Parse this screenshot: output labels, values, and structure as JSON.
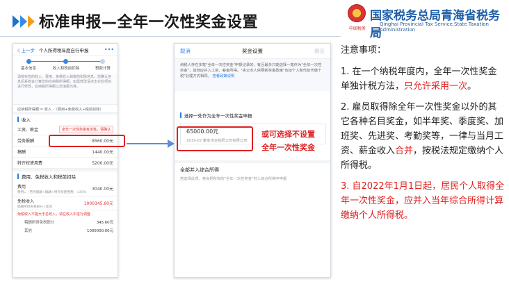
{
  "slide": {
    "title": "标准申报—全年一次性奖金设置",
    "logo_cn": "国家税务总局青海省税务局",
    "logo_en": "Qinghai Provincial Tax Service,State Taxation Administration",
    "logo_seal": "中国税务"
  },
  "phone1": {
    "back": "く上一步",
    "title": "个人所得税年度自行申报",
    "more": "•••",
    "steps": [
      "基本信息",
      "收入和税前扣除",
      "税款计算"
    ],
    "note": "请核实您的收入、费用、免税收入和税前扣除信息，您确认信息后系统会计算您的应纳税所得额，如需修改请点击对应项目进行修改，应纳税所得额以您填报为准。",
    "formula": "应纳税所得额 = 收入 -（费用+免税收入+税前扣除）",
    "income_section": "收入",
    "wage_label": "工资、薪金",
    "wage_tag": "全年一次性奖金有多笔，请确认",
    "rows": [
      {
        "label": "劳务报酬",
        "value": "8560.00元"
      },
      {
        "label": "稿酬",
        "value": "1440.00元"
      },
      {
        "label": "特许权使用费",
        "value": "5200.00元"
      }
    ],
    "deduct_section": "费用、免税收入和税前扣除",
    "fee_label": "费用",
    "fee_value": "3040.00元",
    "fee_sub": "费用=（劳务报酬+稿酬+特许权使用费）×20%",
    "exempt_label": "免税收入",
    "exempt_value": "1000345.60元",
    "exempt_sub": "稿酬所得免税部分+其他",
    "tax_warn": "免税收入不能大于总收入，请在收入中进行调整",
    "mini_rows": [
      {
        "label": "稿酬所得免税部分",
        "value": "345.60元"
      },
      {
        "label": "其他",
        "value": "1000000.00元"
      }
    ]
  },
  "phone2": {
    "cancel": "取消",
    "title": "奖金设置",
    "ok": "确定",
    "note": "纳税人存在多笔\"全年一次性奖金\"申报记录的，有且最多只能选择一笔作为\"全年一次性奖金\"，其他应并入工资、薪金所得。\"夹公杰人依照新奖金政策\"负担个人和代扣代缴个税\"处理方式相同。",
    "note_link": "查看政策说明",
    "option1_title": "选择一处作为全年一次性奖金申报",
    "option1_amount": "65000.00元",
    "option1_sub": "2019-02  聚享诗业有限公司有限公司",
    "option2_title": "全部并入综合所得",
    "option2_sub": "若选择此项，将会把所有的\"全年一次性奖金\"并入综合所得中申报"
  },
  "annotation": {
    "line1": "或可选择不设置",
    "line2": "全年一次性奖金"
  },
  "notes": {
    "heading": "注意事项：",
    "item1_a": "1. 在一个纳税年度内，全年一次性奖金单独计税方法，",
    "item1_b": "只允许采用一次",
    "item1_c": "。",
    "item2_a": "2. 雇员取得除全年一次性奖金以外的其它各种名目奖金，如半年奖、季度奖、加班奖、先进奖、考勤奖等，一律与当月工资、薪金收入",
    "item2_b": "合并",
    "item2_c": "，按税法规定缴纳个人所得税。",
    "item3": "3. 自2022年1月1日起，居民个人取得全年一次性奖金，应并入当年综合所得计算缴纳个人所得税。"
  },
  "colors": {
    "accent_blue": "#2b7de0",
    "highlight_red": "#e02020",
    "logo_blue": "#1f5fa8"
  }
}
